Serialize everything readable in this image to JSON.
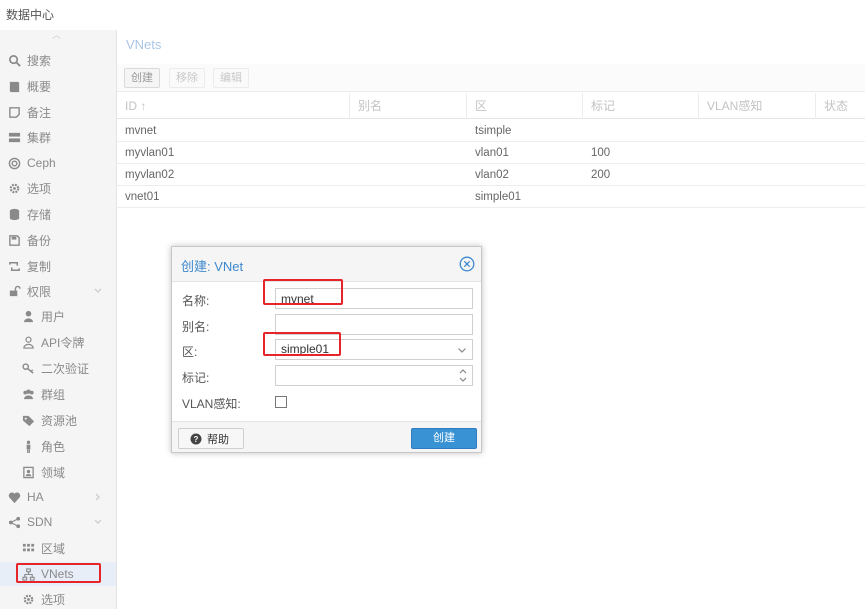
{
  "datacenter": {
    "title": "数据中心"
  },
  "sidebar": {
    "items": [
      {
        "label": "搜索",
        "icon": "search-icon"
      },
      {
        "label": "概要",
        "icon": "book-icon"
      },
      {
        "label": "备注",
        "icon": "note-icon"
      },
      {
        "label": "集群",
        "icon": "server-icon"
      },
      {
        "label": "Ceph",
        "icon": "ceph-icon"
      },
      {
        "label": "选项",
        "icon": "gear-icon"
      },
      {
        "label": "存储",
        "icon": "database-icon"
      },
      {
        "label": "备份",
        "icon": "floppy-icon"
      },
      {
        "label": "复制",
        "icon": "retweet-icon"
      },
      {
        "label": "权限",
        "icon": "unlock-icon"
      },
      {
        "label": "用户",
        "icon": "user-icon"
      },
      {
        "label": "API令牌",
        "icon": "user-outline-icon"
      },
      {
        "label": "二次验证",
        "icon": "key-icon"
      },
      {
        "label": "群组",
        "icon": "users-icon"
      },
      {
        "label": "资源池",
        "icon": "tags-icon"
      },
      {
        "label": "角色",
        "icon": "male-icon"
      },
      {
        "label": "领域",
        "icon": "id-badge-icon"
      },
      {
        "label": "HA",
        "icon": "heartbeat-icon"
      },
      {
        "label": "SDN",
        "icon": "sdn-icon"
      },
      {
        "label": "区域",
        "icon": "grid-icon"
      },
      {
        "label": "VNets",
        "icon": "network-icon"
      },
      {
        "label": "选项",
        "icon": "gear-icon"
      }
    ]
  },
  "panel": {
    "title": "VNets"
  },
  "toolbar": {
    "create": "创建",
    "remove": "移除",
    "edit": "编辑"
  },
  "grid": {
    "columns": [
      "ID ↑",
      "别名",
      "区",
      "标记",
      "VLAN感知",
      "状态"
    ],
    "rows": [
      {
        "id": "mvnet",
        "alias": "",
        "zone": "tsimple",
        "tag": ""
      },
      {
        "id": "myvlan01",
        "alias": "",
        "zone": "vlan01",
        "tag": "100"
      },
      {
        "id": "myvlan02",
        "alias": "",
        "zone": "vlan02",
        "tag": "200"
      },
      {
        "id": "vnet01",
        "alias": "",
        "zone": "simple01",
        "tag": ""
      }
    ]
  },
  "dialog": {
    "title": "创建: VNet",
    "name_label": "名称:",
    "name_value": "mvnet",
    "alias_label": "别名:",
    "alias_value": "",
    "zone_label": "区:",
    "zone_value": "simple01",
    "tag_label": "标记:",
    "tag_value": "",
    "vlan_label": "VLAN感知:",
    "vlan_checked": false,
    "help": "帮助",
    "create": "创建"
  },
  "colors": {
    "accent": "#3892d4",
    "highlight": "#e8242b"
  }
}
